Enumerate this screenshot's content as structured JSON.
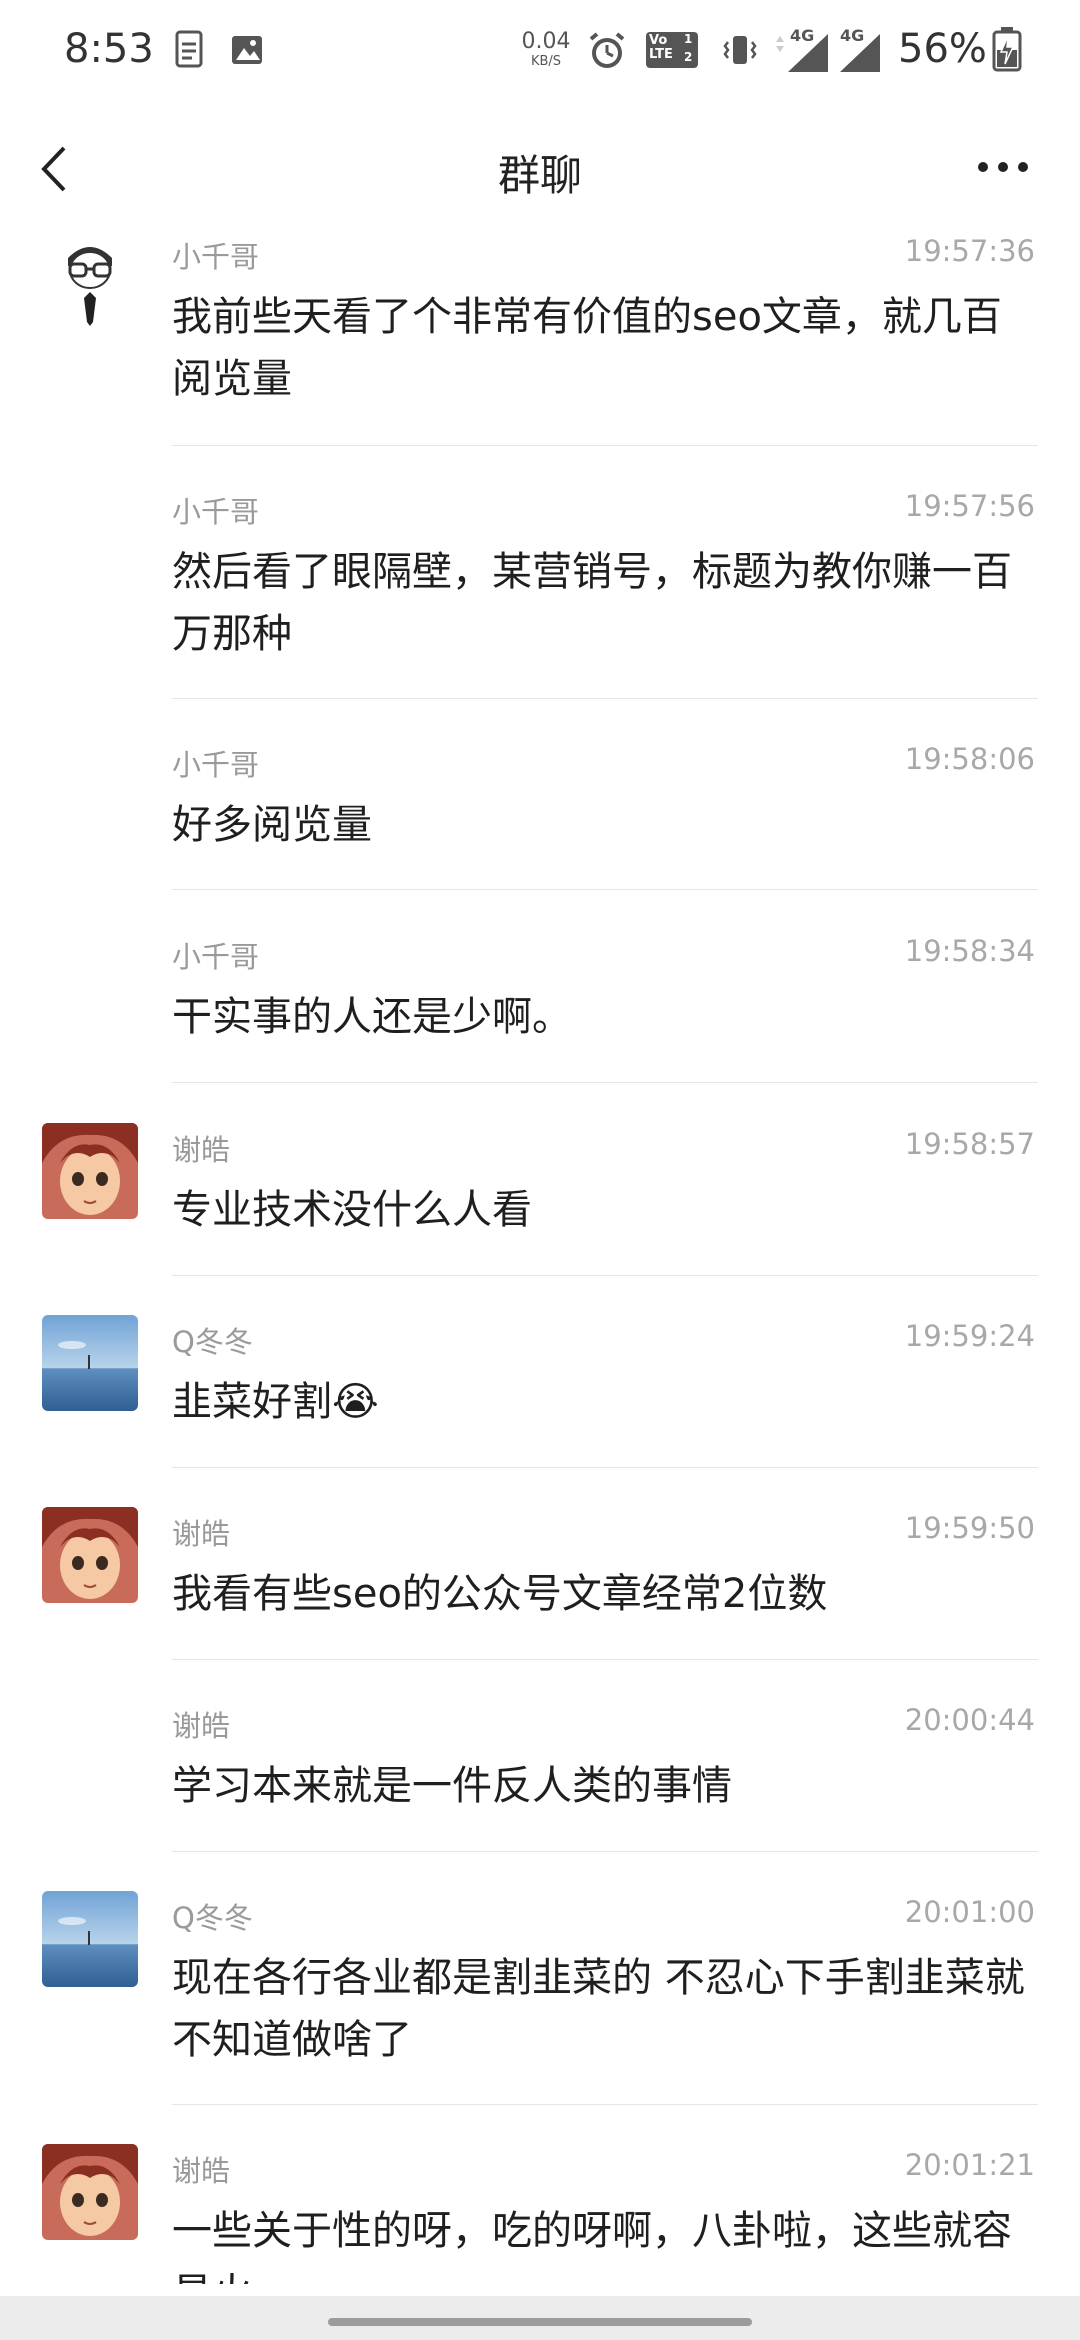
{
  "status_bar": {
    "time": "8:53",
    "net_speed_value": "0.04",
    "net_speed_unit": "KB/S",
    "volte_label": "Vo LTE",
    "volte_num": "1",
    "volte_num2": "2",
    "signal1_label": "4G",
    "signal2_label": "4G",
    "battery_percent": "56%"
  },
  "header": {
    "title": "群聊"
  },
  "messages": [
    {
      "sender": "小千哥",
      "time": "19:57:36",
      "text": "我前些天看了个非常有价值的seo文章，就几百阅览量",
      "avatar": "glasses-man"
    },
    {
      "sender": "小千哥",
      "time": "19:57:56",
      "text": "然后看了眼隔壁，某营销号，标题为教你赚一百万那种",
      "avatar": ""
    },
    {
      "sender": "小千哥",
      "time": "19:58:06",
      "text": "好多阅览量",
      "avatar": ""
    },
    {
      "sender": "小千哥",
      "time": "19:58:34",
      "text": "干实事的人还是少啊。",
      "avatar": ""
    },
    {
      "sender": "谢皓",
      "time": "19:58:57",
      "text": "专业技术没什么人看",
      "avatar": "anime-boy"
    },
    {
      "sender": "Q冬冬",
      "time": "19:59:24",
      "text": "韭菜好割",
      "emoji": "😭",
      "avatar": "lake"
    },
    {
      "sender": "谢皓",
      "time": "19:59:50",
      "text": "我看有些seo的公众号文章经常2位数",
      "avatar": "anime-boy"
    },
    {
      "sender": "谢皓",
      "time": "20:00:44",
      "text": "学习本来就是一件反人类的事情",
      "avatar": ""
    },
    {
      "sender": "Q冬冬",
      "time": "20:01:00",
      "text": "现在各行各业都是割韭菜的 不忍心下手割韭菜就不知道做啥了",
      "avatar": "lake"
    },
    {
      "sender": "谢皓",
      "time": "20:01:21",
      "text": "一些关于性的呀，吃的呀啊，八卦啦，这些就容易火",
      "avatar": "anime-boy"
    }
  ]
}
